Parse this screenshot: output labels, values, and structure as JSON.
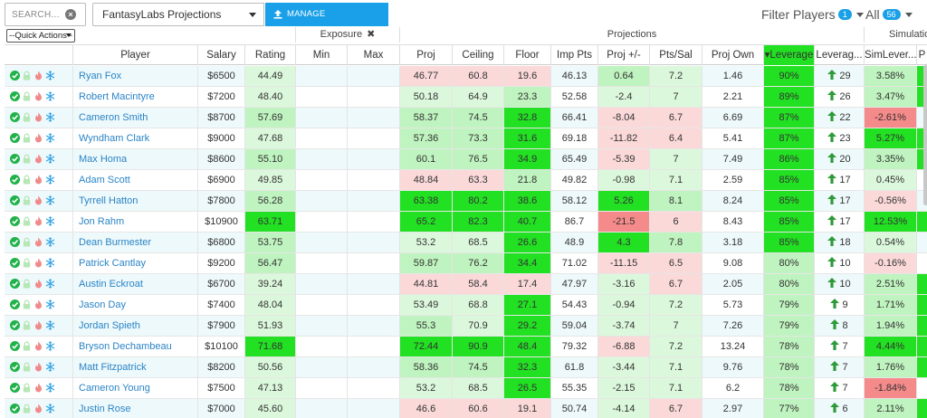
{
  "toolbar": {
    "search_placeholder": "SEARCH...",
    "source_select": "FantasyLabs Projections",
    "manage_label": "MANAGE PROJECTIONS",
    "filter_label": "Filter Players",
    "filter_count": "1",
    "all_label": "All",
    "all_count": "56"
  },
  "table": {
    "quick_actions": "--Quick Actions--",
    "groups": {
      "exposure": "Exposure",
      "projections": "Projections",
      "simulation": "Simulatio"
    },
    "headers": {
      "player": "Player",
      "salary": "Salary",
      "rating": "Rating",
      "min": "Min",
      "max": "Max",
      "proj": "Proj",
      "ceiling": "Ceiling",
      "floor": "Floor",
      "imp_pts": "Imp Pts",
      "proj_pm": "Proj +/-",
      "pts_sal": "Pts/Sal",
      "proj_own": "Proj Own",
      "leverage": "▾Leverage",
      "leverage_rank": "Leverag...",
      "sim_leverage": "SimLever...",
      "extra": "P"
    },
    "rows": [
      {
        "player": "Ryan Fox",
        "salary": "$6500",
        "rating": "44.49",
        "proj": "46.77",
        "ceiling": "60.8",
        "floor": "19.6",
        "imp": "46.13",
        "pm": "0.64",
        "ps": "7.2",
        "own": "1.46",
        "lev": "90%",
        "rank": "29",
        "sim": "3.58%"
      },
      {
        "player": "Robert Macintyre",
        "salary": "$7200",
        "rating": "48.40",
        "proj": "50.18",
        "ceiling": "64.9",
        "floor": "23.3",
        "imp": "52.58",
        "pm": "-2.4",
        "ps": "7",
        "own": "2.21",
        "lev": "89%",
        "rank": "26",
        "sim": "3.47%"
      },
      {
        "player": "Cameron Smith",
        "salary": "$8700",
        "rating": "57.69",
        "proj": "58.37",
        "ceiling": "74.5",
        "floor": "32.8",
        "imp": "66.41",
        "pm": "-8.04",
        "ps": "6.7",
        "own": "6.69",
        "lev": "87%",
        "rank": "22",
        "sim": "-2.61%"
      },
      {
        "player": "Wyndham Clark",
        "salary": "$9000",
        "rating": "47.68",
        "proj": "57.36",
        "ceiling": "73.3",
        "floor": "31.6",
        "imp": "69.18",
        "pm": "-11.82",
        "ps": "6.4",
        "own": "5.41",
        "lev": "87%",
        "rank": "23",
        "sim": "5.27%"
      },
      {
        "player": "Max Homa",
        "salary": "$8600",
        "rating": "55.10",
        "proj": "60.1",
        "ceiling": "76.5",
        "floor": "34.9",
        "imp": "65.49",
        "pm": "-5.39",
        "ps": "7",
        "own": "7.49",
        "lev": "86%",
        "rank": "20",
        "sim": "3.35%"
      },
      {
        "player": "Adam Scott",
        "salary": "$6900",
        "rating": "49.85",
        "proj": "48.84",
        "ceiling": "63.3",
        "floor": "21.8",
        "imp": "49.82",
        "pm": "-0.98",
        "ps": "7.1",
        "own": "2.59",
        "lev": "85%",
        "rank": "17",
        "sim": "0.45%"
      },
      {
        "player": "Tyrrell Hatton",
        "salary": "$7800",
        "rating": "56.28",
        "proj": "63.38",
        "ceiling": "80.2",
        "floor": "38.6",
        "imp": "58.12",
        "pm": "5.26",
        "ps": "8.1",
        "own": "8.24",
        "lev": "85%",
        "rank": "17",
        "sim": "-0.56%"
      },
      {
        "player": "Jon Rahm",
        "salary": "$10900",
        "rating": "63.71",
        "proj": "65.2",
        "ceiling": "82.3",
        "floor": "40.7",
        "imp": "86.7",
        "pm": "-21.5",
        "ps": "6",
        "own": "8.43",
        "lev": "85%",
        "rank": "17",
        "sim": "12.53%"
      },
      {
        "player": "Dean Burmester",
        "salary": "$6800",
        "rating": "53.75",
        "proj": "53.2",
        "ceiling": "68.5",
        "floor": "26.6",
        "imp": "48.9",
        "pm": "4.3",
        "ps": "7.8",
        "own": "3.18",
        "lev": "85%",
        "rank": "18",
        "sim": "0.54%"
      },
      {
        "player": "Patrick Cantlay",
        "salary": "$9200",
        "rating": "56.47",
        "proj": "59.87",
        "ceiling": "76.2",
        "floor": "34.4",
        "imp": "71.02",
        "pm": "-11.15",
        "ps": "6.5",
        "own": "9.08",
        "lev": "80%",
        "rank": "10",
        "sim": "-0.16%"
      },
      {
        "player": "Austin Eckroat",
        "salary": "$6700",
        "rating": "39.24",
        "proj": "44.81",
        "ceiling": "58.4",
        "floor": "17.4",
        "imp": "47.97",
        "pm": "-3.16",
        "ps": "6.7",
        "own": "2.05",
        "lev": "80%",
        "rank": "10",
        "sim": "2.51%"
      },
      {
        "player": "Jason Day",
        "salary": "$7400",
        "rating": "48.04",
        "proj": "53.49",
        "ceiling": "68.8",
        "floor": "27.1",
        "imp": "54.43",
        "pm": "-0.94",
        "ps": "7.2",
        "own": "5.73",
        "lev": "79%",
        "rank": "9",
        "sim": "1.71%"
      },
      {
        "player": "Jordan Spieth",
        "salary": "$7900",
        "rating": "51.93",
        "proj": "55.3",
        "ceiling": "70.9",
        "floor": "29.2",
        "imp": "59.04",
        "pm": "-3.74",
        "ps": "7",
        "own": "7.26",
        "lev": "79%",
        "rank": "8",
        "sim": "1.94%"
      },
      {
        "player": "Bryson Dechambeau",
        "salary": "$10100",
        "rating": "71.68",
        "proj": "72.44",
        "ceiling": "90.9",
        "floor": "48.4",
        "imp": "79.32",
        "pm": "-6.88",
        "ps": "7.2",
        "own": "13.24",
        "lev": "78%",
        "rank": "7",
        "sim": "4.44%"
      },
      {
        "player": "Matt Fitzpatrick",
        "salary": "$8200",
        "rating": "50.56",
        "proj": "58.36",
        "ceiling": "74.5",
        "floor": "32.3",
        "imp": "61.8",
        "pm": "-3.44",
        "ps": "7.1",
        "own": "9.76",
        "lev": "78%",
        "rank": "7",
        "sim": "1.76%"
      },
      {
        "player": "Cameron Young",
        "salary": "$7500",
        "rating": "47.13",
        "proj": "53.2",
        "ceiling": "68.5",
        "floor": "26.5",
        "imp": "55.35",
        "pm": "-2.15",
        "ps": "7.1",
        "own": "6.2",
        "lev": "78%",
        "rank": "7",
        "sim": "-1.84%"
      },
      {
        "player": "Justin Rose",
        "salary": "$7000",
        "rating": "45.60",
        "proj": "46.6",
        "ceiling": "60.6",
        "floor": "19.1",
        "imp": "50.74",
        "pm": "-4.14",
        "ps": "6.7",
        "own": "2.97",
        "lev": "77%",
        "rank": "6",
        "sim": "2.11%"
      }
    ]
  },
  "colors": {
    "accent": "#1aa0e8",
    "link": "#2a84c6",
    "check": "#21b24a",
    "lock": "#b7e6b7",
    "fire": "#f08a8a",
    "snow": "#3aa6e6",
    "arrow": "#2e9a3a",
    "strong_green": "#22e022",
    "light_green": "#bff3bf",
    "pale_green": "#dcf8dc",
    "pink": "#fbd9d9",
    "red": "#f58a8a"
  },
  "icons": [
    "check-circle-icon",
    "lock-icon",
    "fire-icon",
    "snowflake-icon",
    "clear-icon",
    "upload-icon",
    "arrow-up-icon",
    "close-icon"
  ]
}
